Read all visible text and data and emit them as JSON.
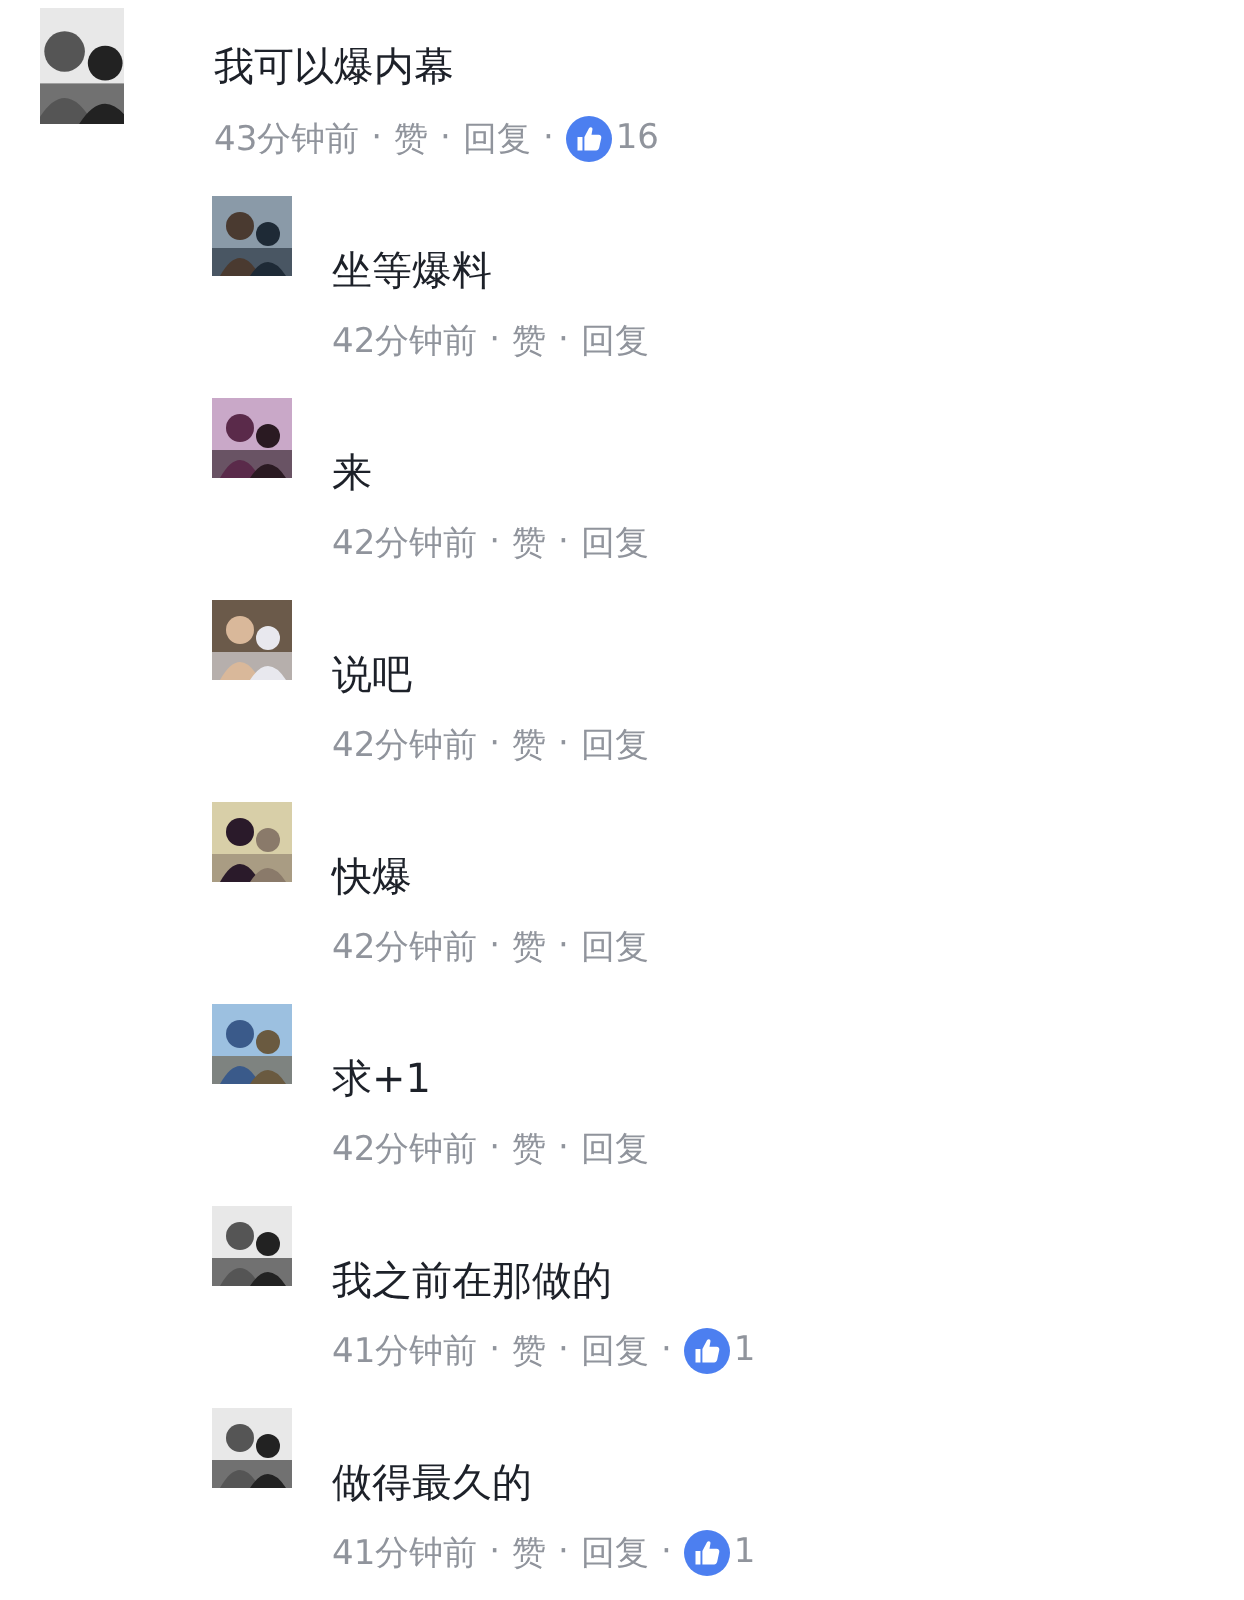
{
  "comments": [
    {
      "text": "我可以爆内幕",
      "time": "43分钟前",
      "sep": "·",
      "like": "赞",
      "reply": "回复",
      "likes": "16"
    },
    {
      "text": "坐等爆料",
      "time": "42分钟前",
      "sep": "·",
      "like": "赞",
      "reply": "回复"
    },
    {
      "text": "来",
      "time": "42分钟前",
      "sep": "·",
      "like": "赞",
      "reply": "回复"
    },
    {
      "text": "说吧",
      "time": "42分钟前",
      "sep": "·",
      "like": "赞",
      "reply": "回复"
    },
    {
      "text": "快爆",
      "time": "42分钟前",
      "sep": "·",
      "like": "赞",
      "reply": "回复"
    },
    {
      "text": "求+1",
      "time": "42分钟前",
      "sep": "·",
      "like": "赞",
      "reply": "回复"
    },
    {
      "text": "我之前在那做的",
      "time": "41分钟前",
      "sep": "·",
      "like": "赞",
      "reply": "回复",
      "likes": "1"
    },
    {
      "text": "做得最久的",
      "time": "41分钟前",
      "sep": "·",
      "like": "赞",
      "reply": "回复",
      "likes": "1"
    }
  ]
}
